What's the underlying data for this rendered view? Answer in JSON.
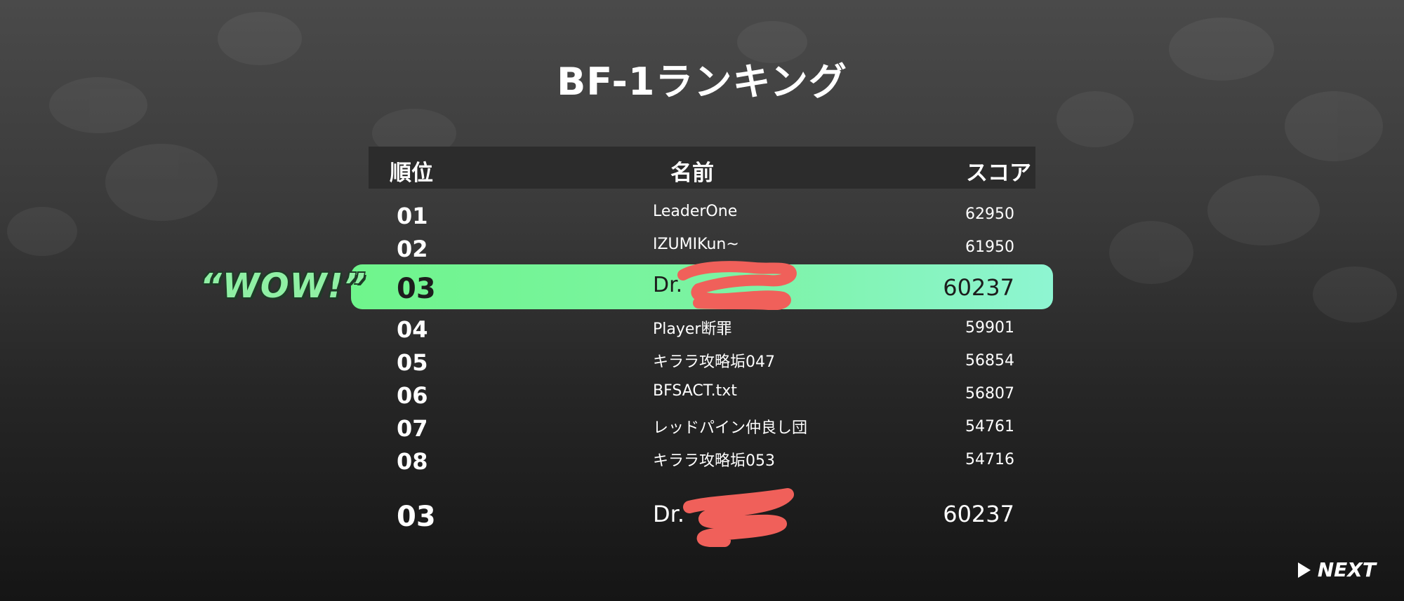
{
  "title": "BF-1ランキング",
  "table": {
    "headers": {
      "rank": "順位",
      "name": "名前",
      "score": "スコア"
    },
    "rows": [
      {
        "rank": "01",
        "name": "LeaderOne",
        "score": "62950"
      },
      {
        "rank": "02",
        "name": "IZUMIKun~",
        "score": "61950"
      },
      {
        "rank": "03",
        "name": "Dr.",
        "score": "60237",
        "highlighted": true
      },
      {
        "rank": "04",
        "name": "Player断罪",
        "score": "59901"
      },
      {
        "rank": "05",
        "name": "キララ攻略垢047",
        "score": "56854"
      },
      {
        "rank": "06",
        "name": "BFSACT.txt",
        "score": "56807"
      },
      {
        "rank": "07",
        "name": "レッドパイン仲良し団",
        "score": "54761"
      },
      {
        "rank": "08",
        "name": "キララ攻略垢053",
        "score": "54716"
      }
    ]
  },
  "player": {
    "rank": "03",
    "name": "Dr.",
    "score": "60237"
  },
  "wow_label": "“WOW!”",
  "next_label": "NEXT",
  "colors": {
    "highlight_start": "#6ff58c",
    "highlight_end": "#8ef5d2",
    "redaction": "#f0605a"
  }
}
